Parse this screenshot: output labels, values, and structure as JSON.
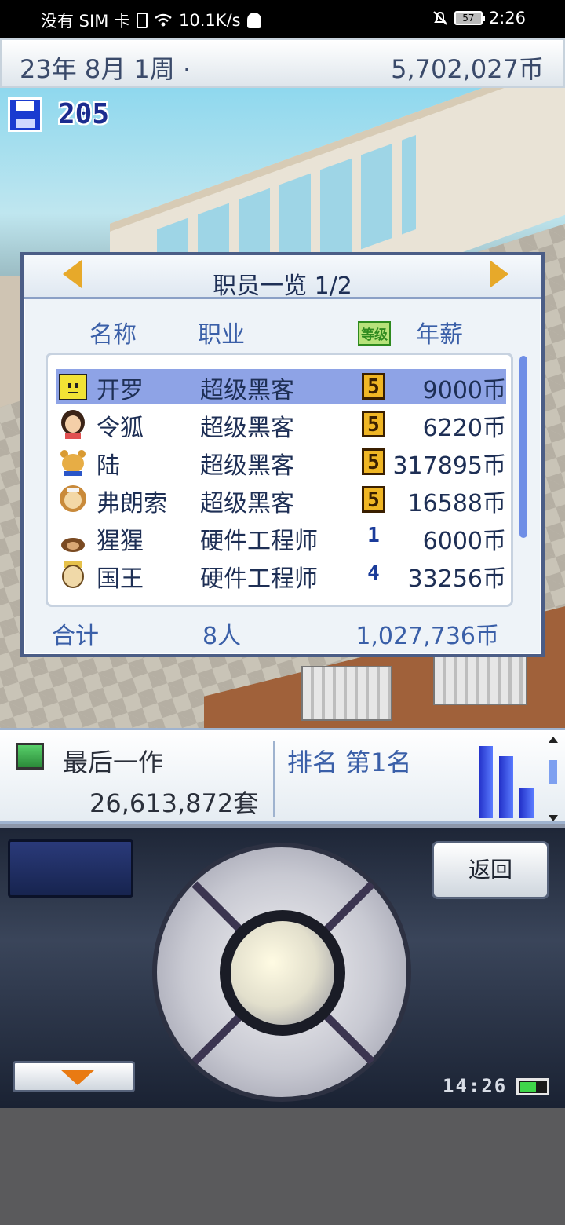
{
  "status_bar": {
    "left_text": "没有 SIM 卡",
    "net_speed": "10.1K/s",
    "battery": "57",
    "time": "2:26"
  },
  "top_bar": {
    "date": "23年 8月 1周 ·",
    "money": "5,702,027币"
  },
  "save_count": "205",
  "staff_dialog": {
    "title": "职员一览 1/2",
    "columns": {
      "name": "名称",
      "job": "职业",
      "grade_icon": "等级",
      "salary": "年薪"
    },
    "rows": [
      {
        "name": "开罗",
        "job": "超级黑客",
        "grade": "5",
        "grade_style": "gold",
        "salary": "9000币",
        "avatar": "yellow-square-avatar-icon"
      },
      {
        "name": "令狐",
        "job": "超级黑客",
        "grade": "5",
        "grade_style": "gold",
        "salary": "6220币",
        "avatar": "girl-avatar-icon"
      },
      {
        "name": "陆",
        "job": "超级黑客",
        "grade": "5",
        "grade_style": "gold",
        "salary": "317895币",
        "avatar": "bear-avatar-icon"
      },
      {
        "name": "弗朗索",
        "job": "超级黑客",
        "grade": "5",
        "grade_style": "gold",
        "salary": "16588币",
        "avatar": "lion-avatar-icon"
      },
      {
        "name": "猩猩",
        "job": "硬件工程师",
        "grade": "1",
        "grade_style": "blue",
        "salary": "6000币",
        "avatar": "ape-avatar-icon"
      },
      {
        "name": "国王",
        "job": "硬件工程师",
        "grade": "4",
        "grade_style": "blue",
        "salary": "33256币",
        "avatar": "king-avatar-icon"
      }
    ],
    "footer": {
      "label": "合计",
      "count": "8人",
      "total": "1,027,736币"
    }
  },
  "info_bar": {
    "last_label": "最后一作",
    "last_value": "26,613,872套",
    "rank": "排名 第1名",
    "rank_bars": [
      1.0,
      0.86,
      0.42
    ]
  },
  "device": {
    "back_label": "返回",
    "clock": "14:26"
  },
  "colors": {
    "accent_blue": "#3a5fa8",
    "selected_row": "#8ea3e6",
    "grade_gold": "#f0b624"
  }
}
